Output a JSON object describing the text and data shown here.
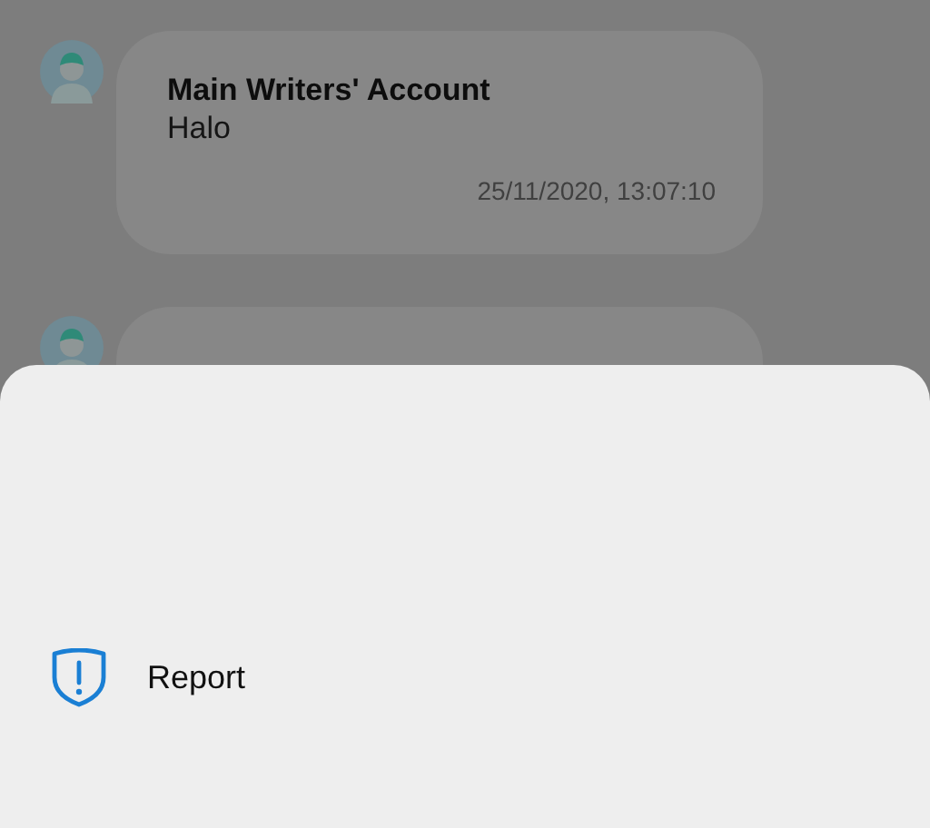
{
  "messages": [
    {
      "kind": "message",
      "sender": "Main Writers' Account",
      "text": "Halo",
      "time": "25/11/2020, 13:07:10"
    },
    {
      "kind": "hidden"
    }
  ],
  "sheet": {
    "actions": [
      {
        "label": "Report",
        "kind": "report"
      }
    ]
  }
}
